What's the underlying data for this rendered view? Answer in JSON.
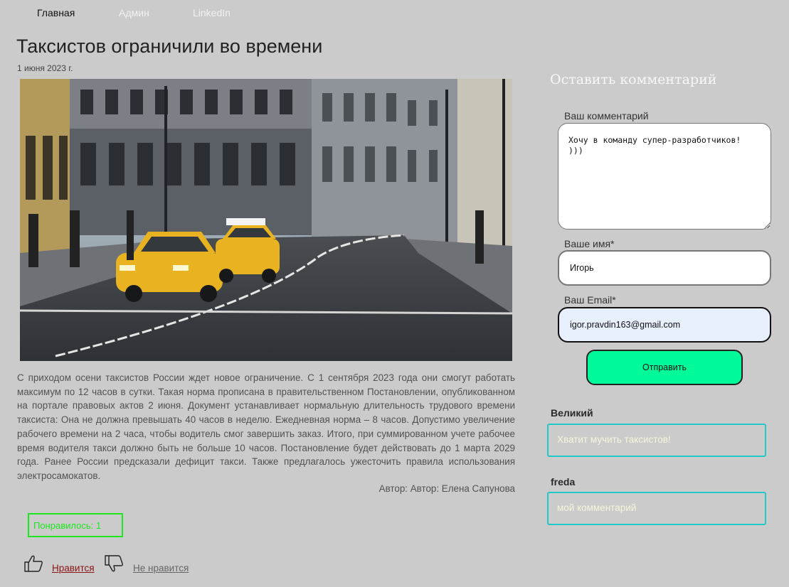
{
  "nav": {
    "home": "Главная",
    "admin": "Админ",
    "linkedin": "LinkedIn"
  },
  "post": {
    "title": "Таксистов ограничили во времени",
    "date": "1 июня 2023 г.",
    "body": "С приходом осени таксистов России ждет новое ограничение. С 1 сентября 2023 года они смогут работать максимум по 12 часов в сутки. Такая норма прописана в правительственном Постановлении, опубликованном на портале правовых актов 2 июня. Документ устанавливает нормальную длительность трудового времени таксиста: Она не должна превышать 40 часов в неделю. Ежедневная норма – 8 часов. Допустимо увеличение рабочего времени на 2 часа, чтобы водитель смог завершить заказ. Итого, при суммированном учете рабочее время водителя такси должно быть не больше 10 часов. Постановление будет действовать до 1 марта 2029 года. Ранее России предсказали дефицит такси. Также предлагалось ужесточить правила использования электросамокатов.",
    "author": "Автор: Автор: Елена Сапунова",
    "likes": "Понравилось: 1",
    "like_link": "Нравится",
    "dislike_link": "Не нравится"
  },
  "form": {
    "heading": "Оставить комментарий",
    "comment_label": "Ваш комментарий",
    "comment_value": "Хочу в команду супер-разработчиков! )))",
    "name_label": "Ваше имя*",
    "name_value": "Игорь",
    "email_label": "Ваш Email*",
    "email_value": "igor.pravdin163@gmail.com",
    "submit": "Отправить"
  },
  "comments": [
    {
      "author": "Великий",
      "text": "Хватит мучить таксистов!"
    },
    {
      "author": "freda",
      "text": "мой комментарий"
    }
  ],
  "icons": {
    "like": "thumbs-up-icon",
    "dislike": "thumbs-down-icon"
  },
  "colors": {
    "background": "#cbcbcb",
    "accent_green": "#00fa9a",
    "likes_border": "#1ee61e",
    "comment_border": "#20c8c8",
    "like_link": "#8a1414"
  }
}
